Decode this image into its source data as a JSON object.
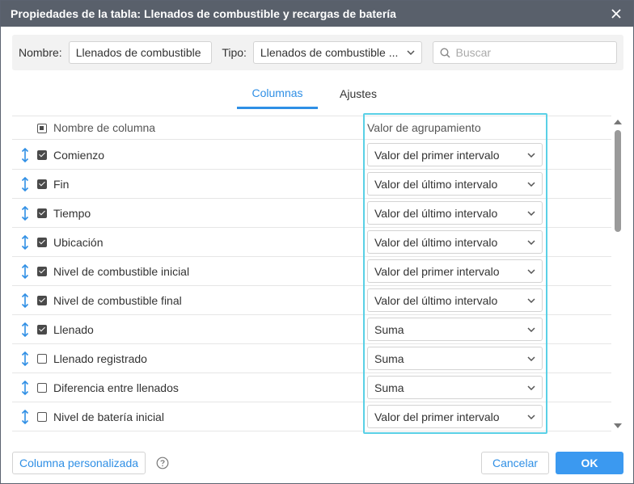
{
  "dialog": {
    "title": "Propiedades de la tabla: Llenados de combustible y recargas de batería"
  },
  "filters": {
    "name_label": "Nombre:",
    "name_value": "Llenados de combustible",
    "type_label": "Tipo:",
    "type_value": "Llenados de combustible ...",
    "search_placeholder": "Buscar"
  },
  "tabs": [
    {
      "label": "Columnas",
      "active": true
    },
    {
      "label": "Ajustes",
      "active": false
    }
  ],
  "table": {
    "header_name": "Nombre de columna",
    "header_value": "Valor de agrupamiento",
    "rows": [
      {
        "name": "Comienzo",
        "checked": true,
        "value": "Valor del primer intervalo"
      },
      {
        "name": "Fin",
        "checked": true,
        "value": "Valor del último intervalo"
      },
      {
        "name": "Tiempo",
        "checked": true,
        "value": "Valor del último intervalo"
      },
      {
        "name": "Ubicación",
        "checked": true,
        "value": "Valor del último intervalo"
      },
      {
        "name": "Nivel de combustible inicial",
        "checked": true,
        "value": "Valor del primer intervalo"
      },
      {
        "name": "Nivel de combustible final",
        "checked": true,
        "value": "Valor del último intervalo"
      },
      {
        "name": "Llenado",
        "checked": true,
        "value": "Suma"
      },
      {
        "name": "Llenado registrado",
        "checked": false,
        "value": "Suma"
      },
      {
        "name": "Diferencia entre llenados",
        "checked": false,
        "value": "Suma"
      },
      {
        "name": "Nivel de batería inicial",
        "checked": false,
        "value": "Valor del primer intervalo"
      }
    ]
  },
  "footer": {
    "custom_column_label": "Columna personalizada",
    "cancel_label": "Cancelar",
    "ok_label": "OK"
  },
  "colors": {
    "accent": "#2f8fe5",
    "titlebar": "#59606b",
    "highlight": "#5ad0e6",
    "ok_button": "#3b99f0"
  }
}
